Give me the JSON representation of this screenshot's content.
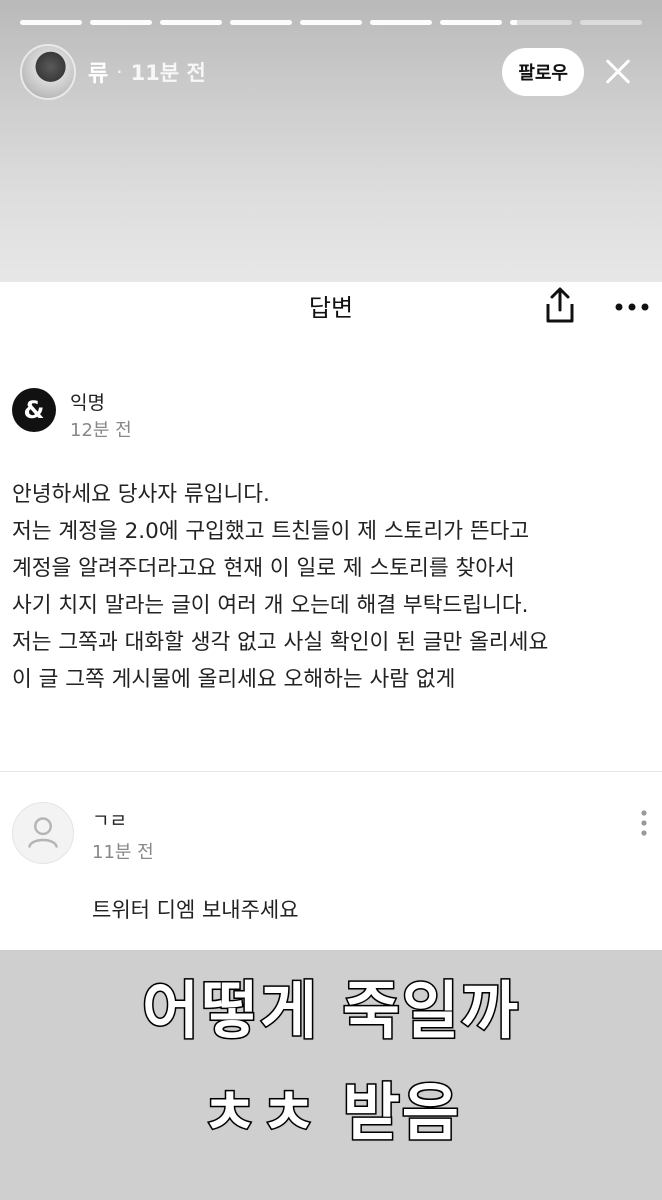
{
  "story": {
    "progress_segments": [
      1,
      1,
      1,
      1,
      1,
      1,
      1,
      0.12,
      0
    ],
    "user": "류",
    "time": "11분 전",
    "follow_label": "팔로우"
  },
  "card": {
    "title": "답변",
    "post": {
      "avatar_glyph": "&",
      "author": "익명",
      "time": "12분 전",
      "body": "안녕하세요 당사자 류입니다.\n저는 계정을 2.0에 구입했고 트친들이 제 스토리가 뜬다고\n계정을 알려주더라고요 현재 이 일로 제 스토리를 찾아서\n사기 치지 말라는 글이 여러 개 오는데 해결 부탁드립니다.\n저는 그쪽과 대화할 생각 없고 사실 확인이 된 글만 올리세요\n이 글 그쪽 게시물에 올리세요 오해하는 사람 없게"
    },
    "reply": {
      "author": "ㄱㄹ",
      "time": "11분 전",
      "body": "트위터 디엠 보내주세요"
    }
  },
  "caption": {
    "line1": "어떻게 죽일까",
    "line2": "ㅊㅊ 받음"
  },
  "icons": {
    "share": "share-icon",
    "more": "more-horizontal-icon",
    "close": "close-icon",
    "reply_more": "more-vertical-icon",
    "reply_avatar": "user-placeholder-icon"
  }
}
